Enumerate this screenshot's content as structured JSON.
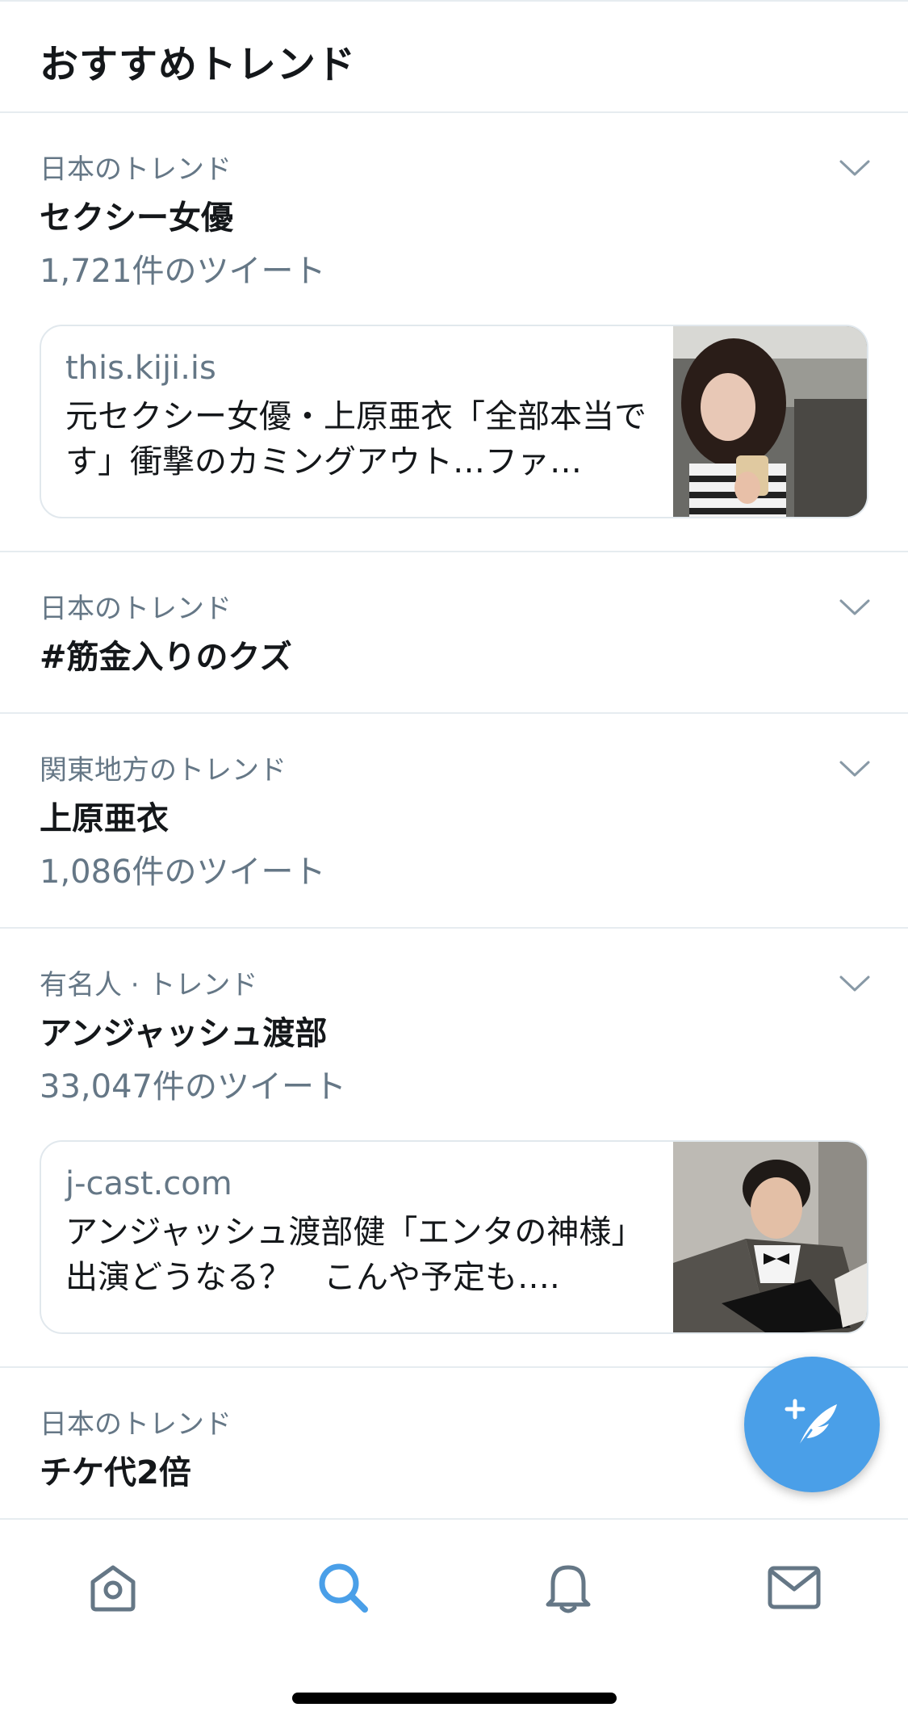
{
  "header": {
    "title": "おすすめトレンド"
  },
  "trends": [
    {
      "context": "日本のトレンド",
      "name": "セクシー女優",
      "count": "1,721件のツイート",
      "card": {
        "domain": "this.kiji.is",
        "headline": "元セクシー女優・上原亜衣「全部本当です」衝撃のカミングアウト…ファ…"
      }
    },
    {
      "context": "日本のトレンド",
      "name": "#筋金入りのクズ"
    },
    {
      "context": "関東地方のトレンド",
      "name": "上原亜衣",
      "count": "1,086件のツイート"
    },
    {
      "context": "有名人 · トレンド",
      "name": "アンジャッシュ渡部",
      "count": "33,047件のツイート",
      "card": {
        "domain": "j-cast.com",
        "headline": "アンジャッシュ渡部健「エンタの神様」出演どうなる？　こんや予定も…."
      }
    },
    {
      "context": "日本のトレンド",
      "name": "チケ代2倍"
    }
  ],
  "colors": {
    "accent": "#4a9fe8",
    "secondary_text": "#657786",
    "divider": "#e6ecf0"
  },
  "icons": {
    "chevron": "chevron-down-icon",
    "home": "home-icon",
    "search": "search-icon",
    "notifications": "bell-icon",
    "messages": "mail-icon",
    "compose": "compose-tweet-icon"
  }
}
